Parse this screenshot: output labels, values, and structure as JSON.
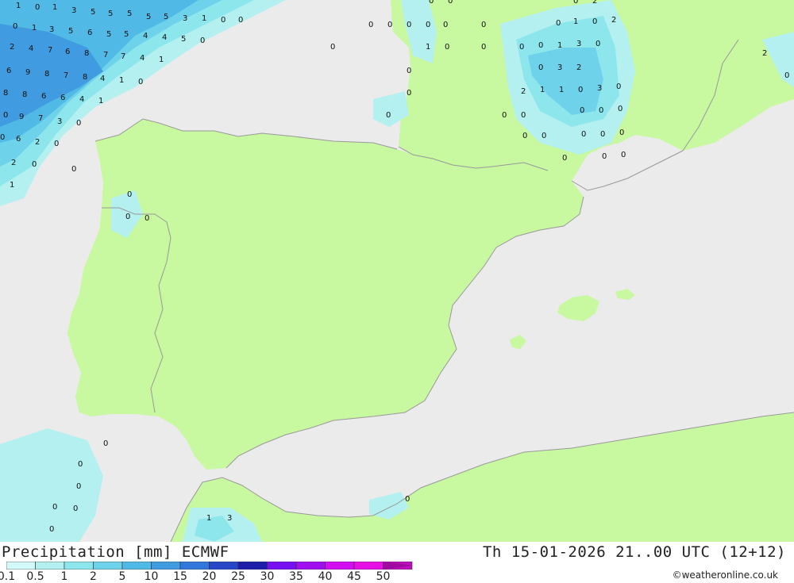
{
  "map": {
    "colors": {
      "sea": "#ebebeb",
      "land": "#c8f8a0",
      "border": "#999999",
      "coast": "#8f8f8f"
    },
    "value_labels": [
      "1",
      "0",
      "1",
      "3",
      "5",
      "5",
      "5",
      "5",
      "5",
      "3",
      "1",
      "0",
      "0",
      "0",
      "1",
      "3",
      "5",
      "6",
      "5",
      "5",
      "4",
      "4",
      "5",
      "0",
      "2",
      "4",
      "7",
      "6",
      "8",
      "7",
      "7",
      "4",
      "1",
      "6",
      "9",
      "8",
      "7",
      "8",
      "4",
      "1",
      "0",
      "8",
      "8",
      "6",
      "6",
      "4",
      "1",
      "0",
      "9",
      "7",
      "3",
      "0",
      "0",
      "6",
      "2",
      "0",
      "2",
      "0",
      "0",
      "1",
      "0",
      "0",
      "0",
      "0",
      "0",
      "0",
      "0",
      "0",
      "0",
      "0",
      "1",
      "0",
      "0",
      "0",
      "0",
      "0",
      "0",
      "0",
      "0",
      "0",
      "0",
      "0",
      "0",
      "0",
      "0",
      "0",
      "0",
      "0",
      "0",
      "0",
      "0",
      "1",
      "3",
      "0",
      "0",
      "0",
      "1",
      "3",
      "0",
      "0",
      "3",
      "2",
      "2",
      "1",
      "1",
      "0",
      "3",
      "0",
      "0",
      "0",
      "0",
      "0",
      "0",
      "1",
      "0",
      "0",
      "2",
      "2",
      "2",
      "0",
      "0",
      "0",
      "1",
      "0",
      "0",
      "0"
    ]
  },
  "legend": {
    "title": "Precipitation [mm] ECMWF",
    "ticks": [
      "0.1",
      "0.5",
      "1",
      "2",
      "5",
      "10",
      "15",
      "20",
      "25",
      "30",
      "35",
      "40",
      "45",
      "50"
    ],
    "colors": [
      "#d2fafa",
      "#b4f0f0",
      "#8ce6eb",
      "#6ed2eb",
      "#50b9e6",
      "#419be1",
      "#3278dc",
      "#2846c8",
      "#1e1eaa",
      "#780ff0",
      "#a00ff0",
      "#d20ff0",
      "#e60fe6",
      "#be0fbe"
    ],
    "arrow_color": "#a00aa0"
  },
  "valid_time": "Th 15-01-2026 21..00 UTC (12+12)",
  "credit": "©weatheronline.co.uk"
}
